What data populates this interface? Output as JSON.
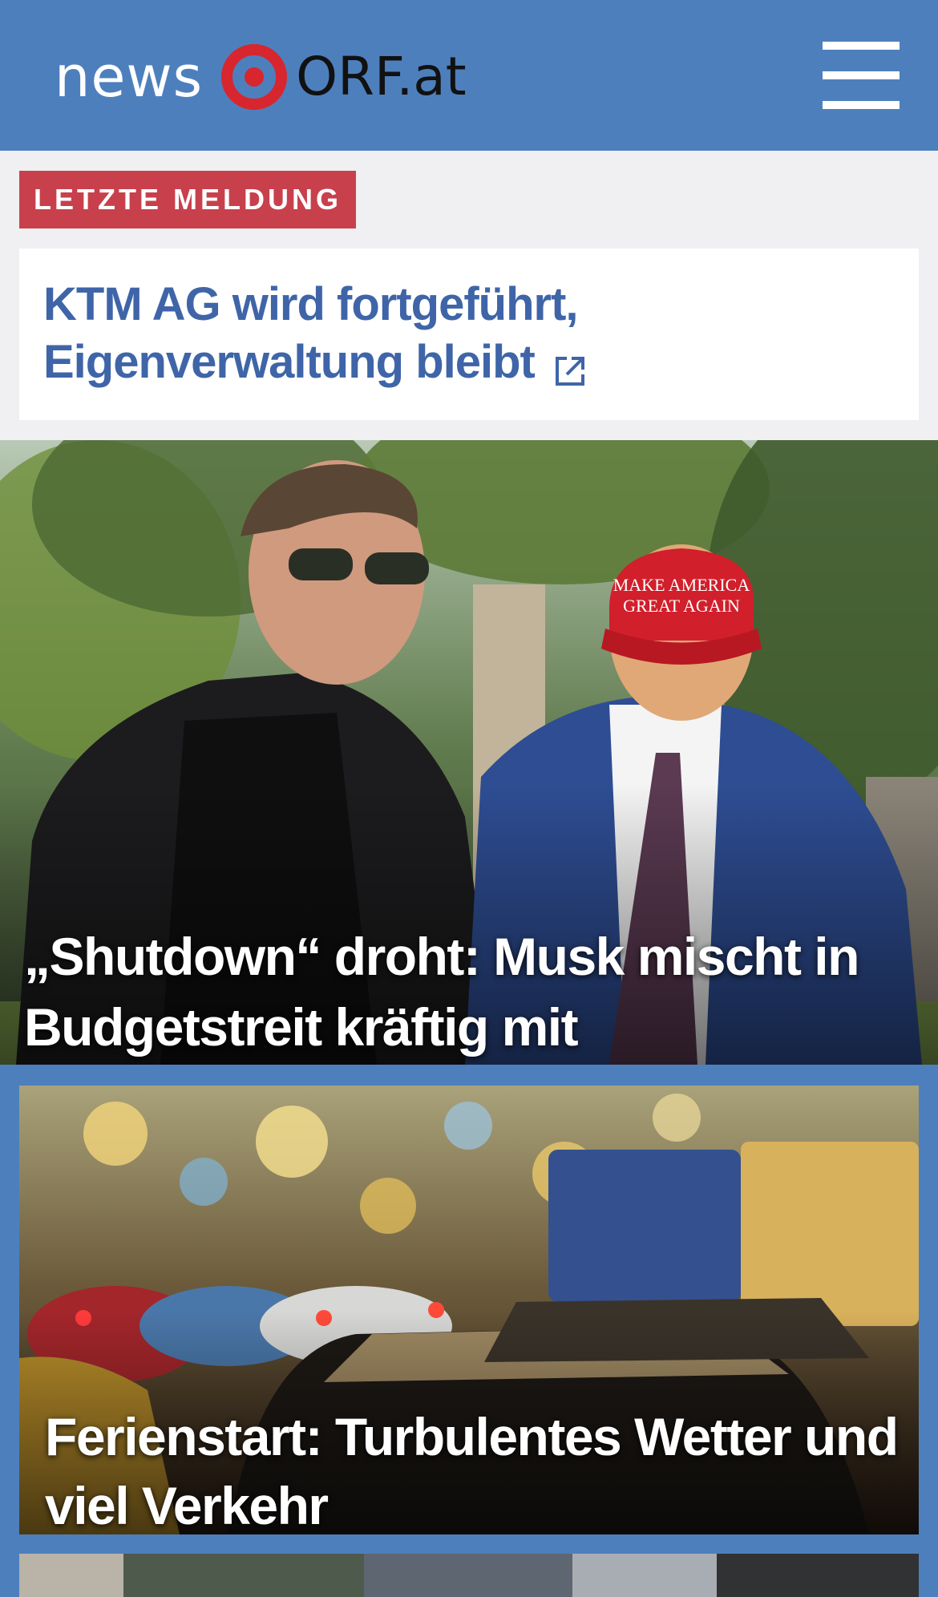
{
  "header": {
    "logo_news": "news",
    "logo_orf": "ORF.at",
    "menu_icon": "hamburger-menu-icon",
    "brand_color": "#4e7fbd",
    "logo_ring_color": "#d7262e"
  },
  "breaking": {
    "badge_label": "LETZTE MELDUNG",
    "badge_color": "#c8404c",
    "title": "KTM AG wird fortgeführt, Eigenverwaltung bleibt",
    "title_color": "#3f65a8",
    "link_icon": "external-link-icon"
  },
  "stories": [
    {
      "headline": "„Shutdown“ droht: Musk mischt in Budgetstreit kräftig mit",
      "image": "photo-two-men-talking-outdoors-red-cap"
    },
    {
      "headline": "Ferienstart: Turbulentes Wetter und viel Verkehr",
      "image": "photo-traffic-jam-christmas-lights"
    },
    {
      "headline": "",
      "image": "photo-city-street-partial"
    }
  ]
}
